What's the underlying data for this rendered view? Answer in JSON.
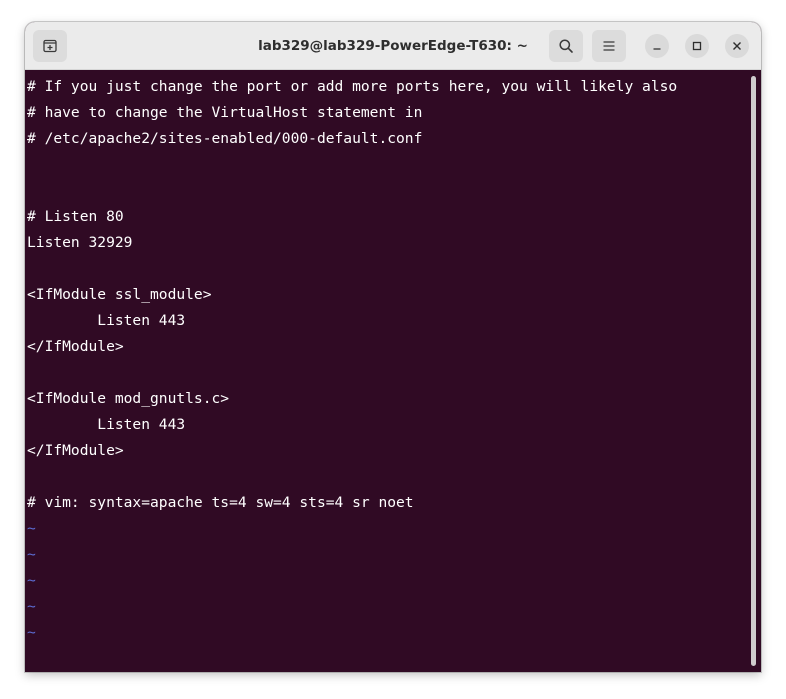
{
  "window": {
    "title": "lab329@lab329-PowerEdge-T630: ~"
  },
  "titlebar": {
    "new_tab_icon": "new-tab-icon",
    "search_icon": "search-icon",
    "menu_icon": "hamburger-menu-icon",
    "minimize_icon": "minimize-icon",
    "maximize_icon": "maximize-icon",
    "close_icon": "close-icon"
  },
  "colors": {
    "terminal_background": "#300a24",
    "text": "#ffffff",
    "tilde": "#5b6bd0",
    "titlebar": "#ebebeb"
  },
  "editor": {
    "lines": [
      "# If you just change the port or add more ports here, you will likely also",
      "# have to change the VirtualHost statement in",
      "# /etc/apache2/sites-enabled/000-default.conf",
      "",
      "",
      "# Listen 80",
      "Listen 32929",
      "",
      "<IfModule ssl_module>",
      "        Listen 443",
      "</IfModule>",
      "",
      "<IfModule mod_gnutls.c>",
      "        Listen 443",
      "</IfModule>",
      "",
      "# vim: syntax=apache ts=4 sw=4 sts=4 sr noet"
    ],
    "empty_markers": [
      "~",
      "~",
      "~",
      "~",
      "~"
    ]
  }
}
